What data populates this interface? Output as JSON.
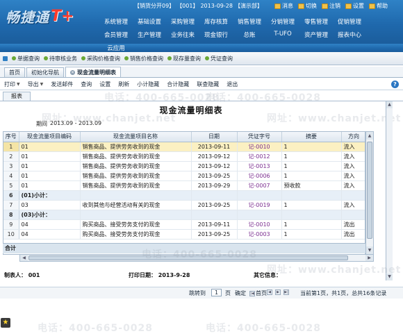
{
  "header": {
    "logo_text": "畅捷通",
    "logo_tplus": "T+",
    "account_info": [
      "【销货分开09】",
      "【001】",
      "2013-09-28",
      "【演示部】"
    ],
    "actions": [
      {
        "label": "消息",
        "icon": "message-icon"
      },
      {
        "label": "切换",
        "icon": "switch-icon"
      },
      {
        "label": "注销",
        "icon": "logout-icon"
      },
      {
        "label": "设置",
        "icon": "settings-icon"
      },
      {
        "label": "帮助",
        "icon": "help-icon"
      }
    ],
    "menu_row1": [
      "系统管理",
      "基础设置",
      "采购管理",
      "库存核算",
      "销售管理",
      "分销管理",
      "零售管理",
      "促销管理"
    ],
    "menu_row2": [
      "会员管理",
      "生产管理",
      "业务往来",
      "现金银行",
      "总账",
      "T-UFO",
      "资产管理",
      "报表中心"
    ],
    "menu_row3": "云应用"
  },
  "strip": [
    "单据查询",
    "待审核业务",
    "采购价格查询",
    "销售价格查询",
    "现存量查询",
    "凭证查询"
  ],
  "tabs": [
    {
      "label": "首页",
      "active": false
    },
    {
      "label": "初始化导航",
      "active": false
    },
    {
      "label": "现金流量明细表",
      "active": true
    }
  ],
  "commands": [
    {
      "label": "打印",
      "dropdown": true
    },
    {
      "label": "导出",
      "dropdown": true
    },
    {
      "label": "发送邮件",
      "dropdown": false
    },
    {
      "label": "查询",
      "dropdown": false
    },
    {
      "label": "设置",
      "dropdown": false
    },
    {
      "label": "刷新",
      "dropdown": false
    },
    {
      "label": "小计隐藏",
      "dropdown": false
    },
    {
      "label": "合计隐藏",
      "dropdown": false
    },
    {
      "label": "联查隐藏",
      "dropdown": false
    },
    {
      "label": "退出",
      "dropdown": false
    }
  ],
  "report": {
    "tab_label": "报表",
    "title": "现金流量明细表",
    "period_label": "期间",
    "period_value": "2013.09 - 2013.09",
    "columns": [
      "序号",
      "现金流量项目编码",
      "现金流量项目名称",
      "日期",
      "凭证字号",
      "摘要",
      "方向"
    ],
    "rows": [
      {
        "no": "1",
        "code": "01",
        "name": "销售商品、提供劳务收到的现金",
        "date": "2013-09-11",
        "voucher": "记-0010",
        "summary": "1",
        "dir": "流入",
        "type": "selected"
      },
      {
        "no": "2",
        "code": "01",
        "name": "销售商品、提供劳务收到的现金",
        "date": "2013-09-12",
        "voucher": "记-0012",
        "summary": "1",
        "dir": "流入",
        "type": "normal"
      },
      {
        "no": "3",
        "code": "01",
        "name": "销售商品、提供劳务收到的现金",
        "date": "2013-09-12",
        "voucher": "记-0013",
        "summary": "1",
        "dir": "流入",
        "type": "normal"
      },
      {
        "no": "4",
        "code": "01",
        "name": "销售商品、提供劳务收到的现金",
        "date": "2013-09-25",
        "voucher": "记-0006",
        "summary": "1",
        "dir": "流入",
        "type": "normal"
      },
      {
        "no": "5",
        "code": "01",
        "name": "销售商品、提供劳务收到的现金",
        "date": "2013-09-29",
        "voucher": "记-0007",
        "summary": "预收款",
        "dir": "流入",
        "type": "normal"
      },
      {
        "no": "6",
        "code": "(01)小计：",
        "name": "",
        "date": "",
        "voucher": "",
        "summary": "",
        "dir": "",
        "type": "subtotal"
      },
      {
        "no": "7",
        "code": "03",
        "name": "收到其他与经营活动有关的现金",
        "date": "2013-09-25",
        "voucher": "记-0019",
        "summary": "1",
        "dir": "流入",
        "type": "normal"
      },
      {
        "no": "8",
        "code": "(03)小计：",
        "name": "",
        "date": "",
        "voucher": "",
        "summary": "",
        "dir": "",
        "type": "subtotal"
      },
      {
        "no": "9",
        "code": "04",
        "name": "购买商品、接受劳务支付的现金",
        "date": "2013-09-11",
        "voucher": "记-0010",
        "summary": "1",
        "dir": "流出",
        "type": "normal"
      },
      {
        "no": "10",
        "code": "04",
        "name": "购买商品、接受劳务支付的现金",
        "date": "2013-09-25",
        "voucher": "记-0003",
        "summary": "1",
        "dir": "流出",
        "type": "normal"
      }
    ],
    "total_label": "合计"
  },
  "footer": {
    "maker_label": "制表人：",
    "maker_value": "001",
    "print_date_label": "打印日期：",
    "print_date_value": "2013-9-28",
    "other_label": "其它信息："
  },
  "pager": {
    "goto_label": "跳转到",
    "page_value": "1",
    "page_unit": "页",
    "confirm": "确定",
    "first": "首页",
    "prev": "上一页",
    "next": "下一页",
    "last": "末页",
    "status": "当前第1页，共1页，总共16条记录"
  },
  "watermarks": {
    "phone": "电话：400-665-0028",
    "site": "网址：www.chanjet.net"
  }
}
